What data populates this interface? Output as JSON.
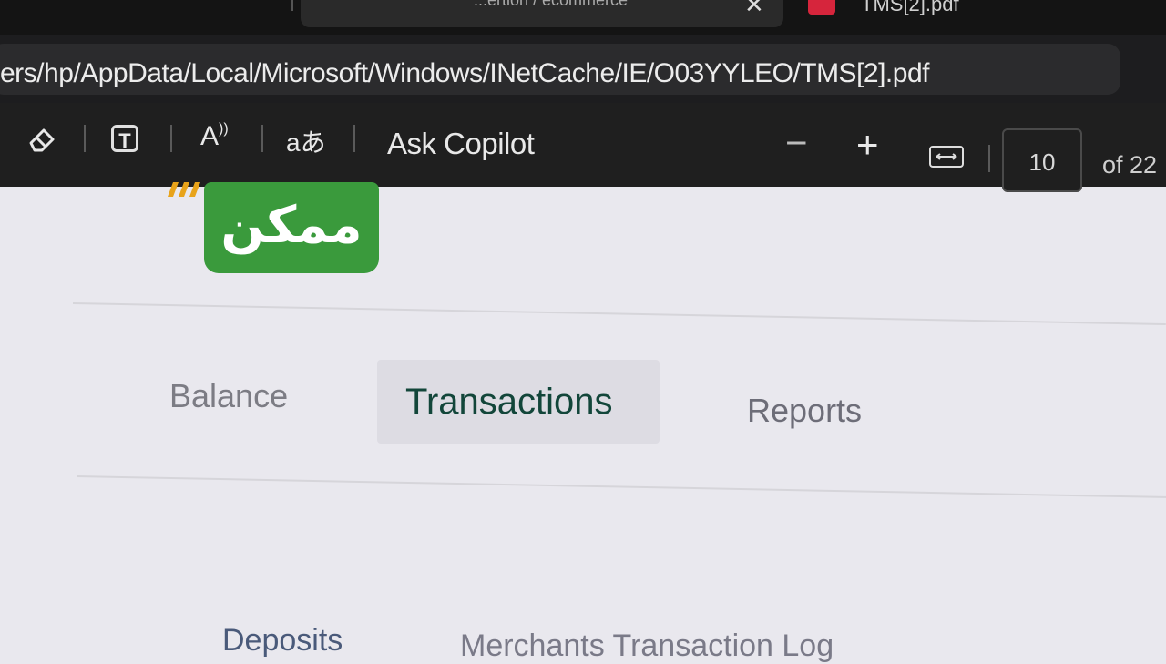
{
  "browser": {
    "tabs": [
      {
        "title": "...",
        "active": false
      },
      {
        "title": "...ertion / ecommerce",
        "active": true
      },
      {
        "title": "TMS[2].pdf",
        "active": false
      }
    ],
    "address": "ers/hp/AppData/Local/Microsoft/Windows/INetCache/IE/O03YYLEO/TMS[2].pdf"
  },
  "pdf_toolbar": {
    "erase_icon": "eraser-icon",
    "text_icon": "text-box-icon",
    "read_aloud_icon": "read-aloud-icon",
    "translate_label": "aあ",
    "copilot_label": "Ask Copilot",
    "zoom_out": "−",
    "zoom_in": "+",
    "fit_icon": "fit-width-icon",
    "page_current": "10",
    "page_total": "of 22"
  },
  "page": {
    "logo_text": "ممكن",
    "tabs": [
      {
        "label": "Balance",
        "selected": false
      },
      {
        "label": "Transactions",
        "selected": true
      },
      {
        "label": "Reports",
        "selected": false
      }
    ],
    "subtabs": [
      {
        "label": "Deposits"
      },
      {
        "label": "Merchants Transaction Log"
      }
    ]
  },
  "colors": {
    "logo_green": "#3a9a3c",
    "selected_tab_text": "#12463a",
    "toolbar_bg": "#1f1f1f"
  }
}
